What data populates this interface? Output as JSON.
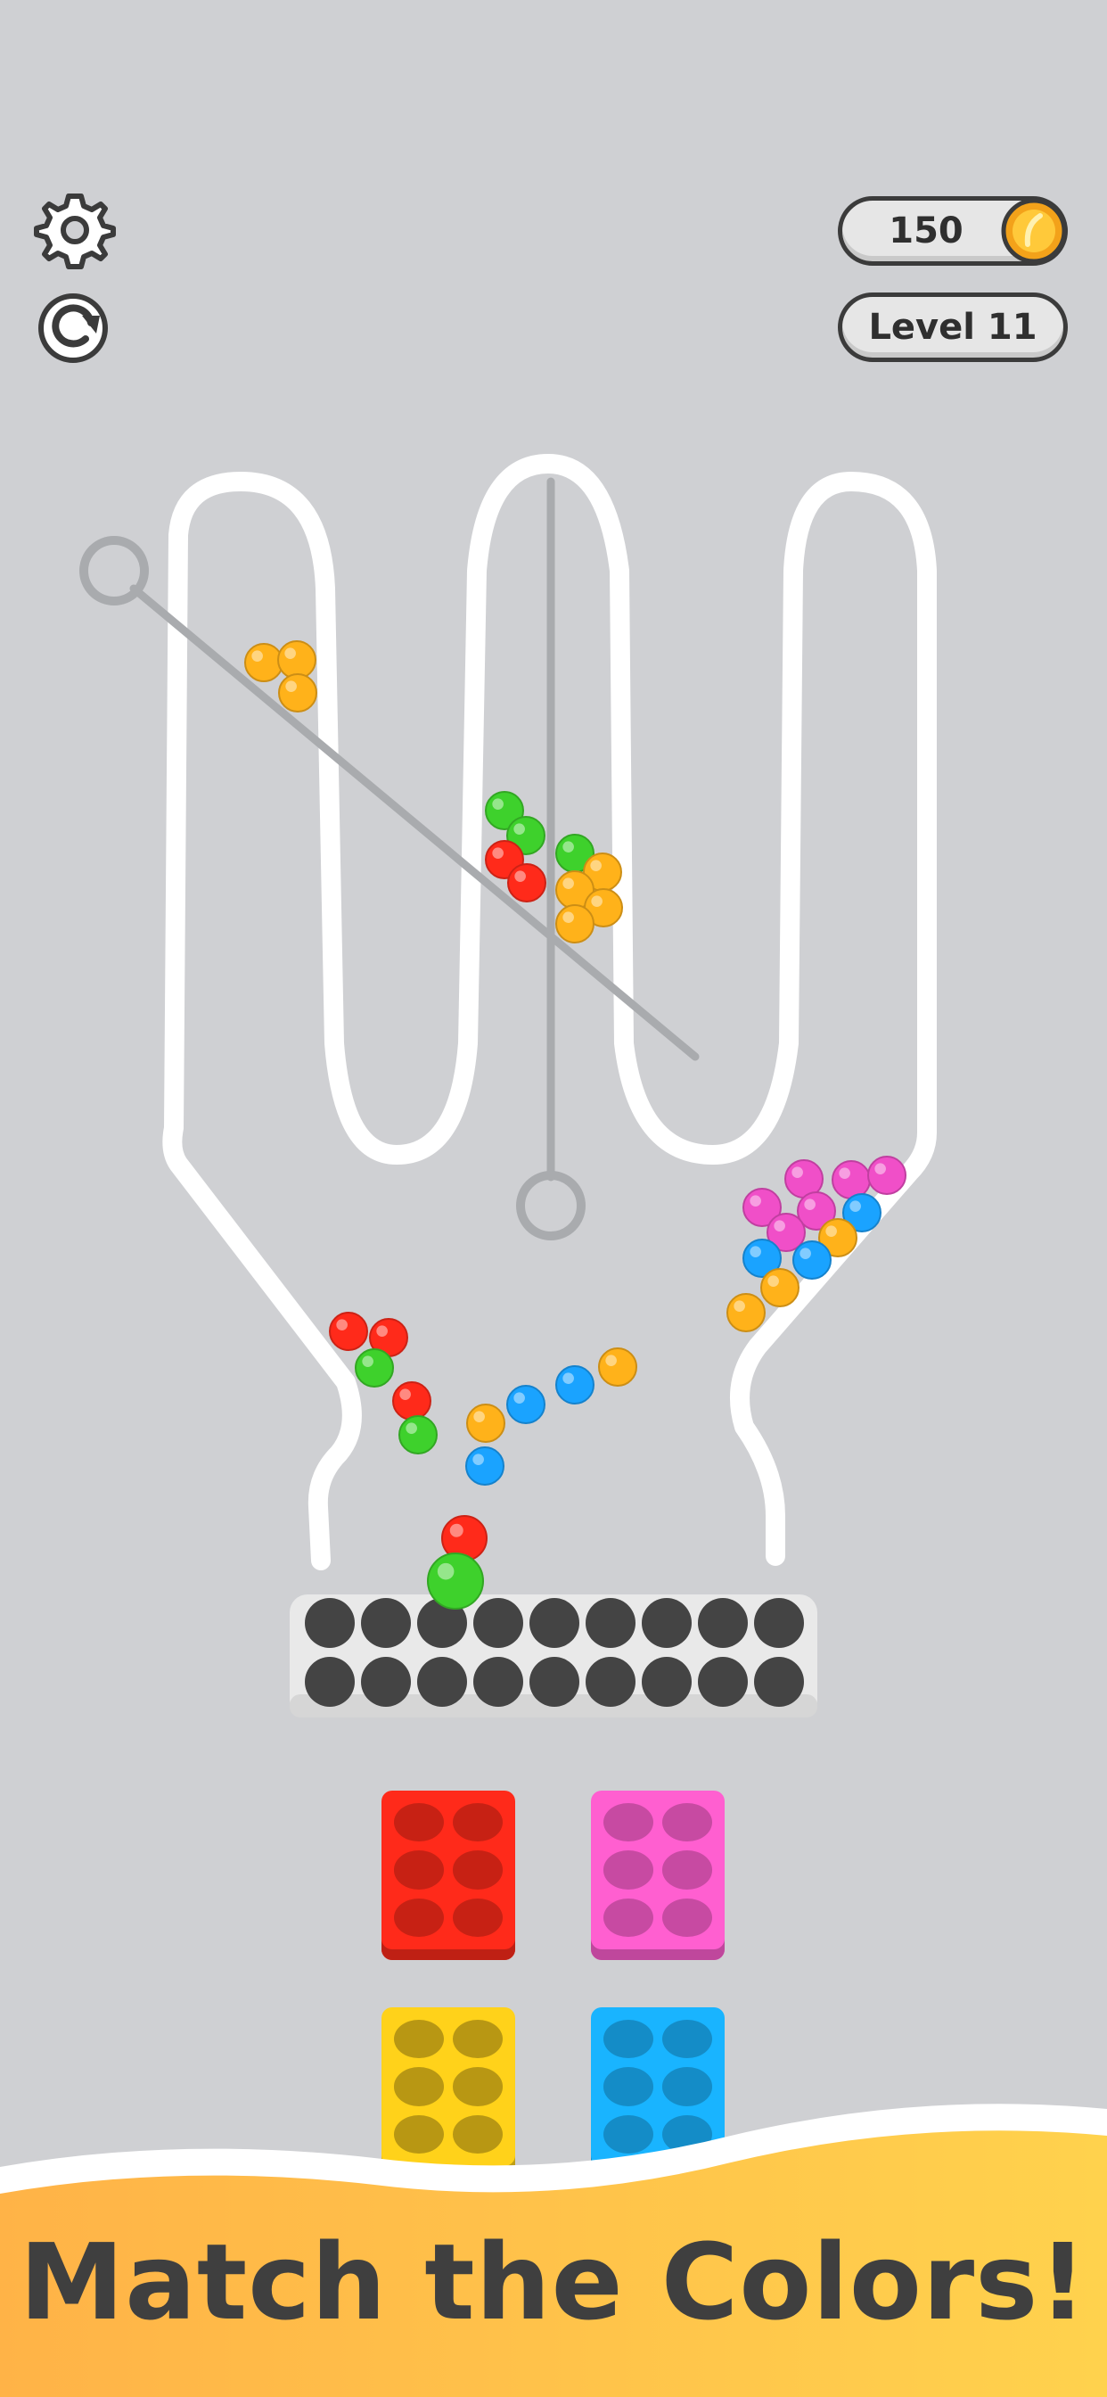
{
  "hud": {
    "coins": "150",
    "level": "Level 11",
    "settings_icon": "gear-icon",
    "restart_icon": "restart-icon",
    "coin_icon": "coin-icon"
  },
  "banner": {
    "text": "Match the Colors!"
  },
  "colors": {
    "background": "#cfd0d3",
    "red": "#ff2a1a",
    "green": "#3ed12c",
    "orange": "#ffb21a",
    "blue": "#1aa3ff",
    "pink": "#f04fc8",
    "yellow": "#ffd21a",
    "tray_pink": "#ff5fd0",
    "tray_blue": "#19b4ff",
    "banner_left": "#ffb347",
    "banner_right": "#ffd24d"
  },
  "board": {
    "slot_rows": 2,
    "slots_per_row": 9
  },
  "trays": [
    {
      "name": "red-tray",
      "color": "red"
    },
    {
      "name": "pink-tray",
      "color": "pink"
    },
    {
      "name": "yellow-tray",
      "color": "yellow"
    },
    {
      "name": "blue-tray",
      "color": "blue"
    }
  ]
}
